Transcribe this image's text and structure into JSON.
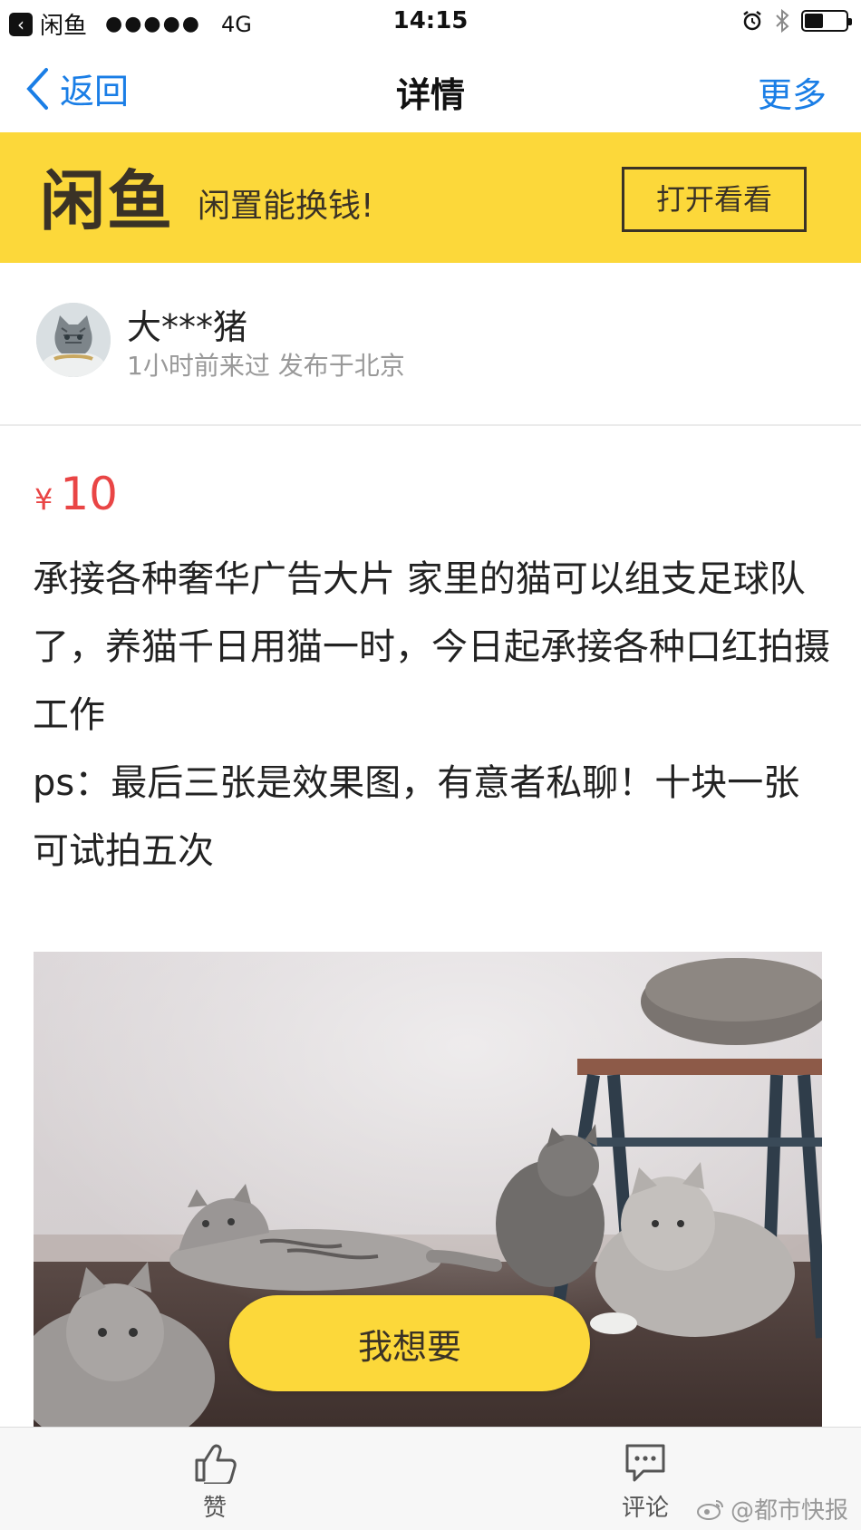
{
  "status_bar": {
    "app": "闲鱼",
    "signal": "●●●●●",
    "network": "4G",
    "time": "14:15",
    "battery_level": 0.45,
    "icons": [
      "alarm-icon",
      "bluetooth-icon",
      "battery-icon"
    ]
  },
  "nav": {
    "back_label": "返回",
    "title": "详情",
    "more_label": "更多"
  },
  "banner": {
    "logo": "闲鱼",
    "slogan": "闲置能换钱!",
    "open_label": "打开看看"
  },
  "user": {
    "name": "大***猪",
    "meta": "1小时前来过 发布于北京"
  },
  "price": {
    "currency": "¥",
    "amount": "10"
  },
  "description": "承接各种奢华广告大片 家里的猫可以组支足球队了，养猫千日用猫一时，今日起承接各种口红拍摄工作\nps：最后三张是效果图，有意者私聊！十块一张可试拍五次",
  "action": {
    "want_label": "我想要"
  },
  "bottom_bar": {
    "like_label": "赞",
    "comment_label": "评论"
  },
  "watermark": "@都市快报",
  "colors": {
    "brand_yellow": "#fcd83a",
    "price_red": "#e94545",
    "link_blue": "#1a7ee6"
  }
}
